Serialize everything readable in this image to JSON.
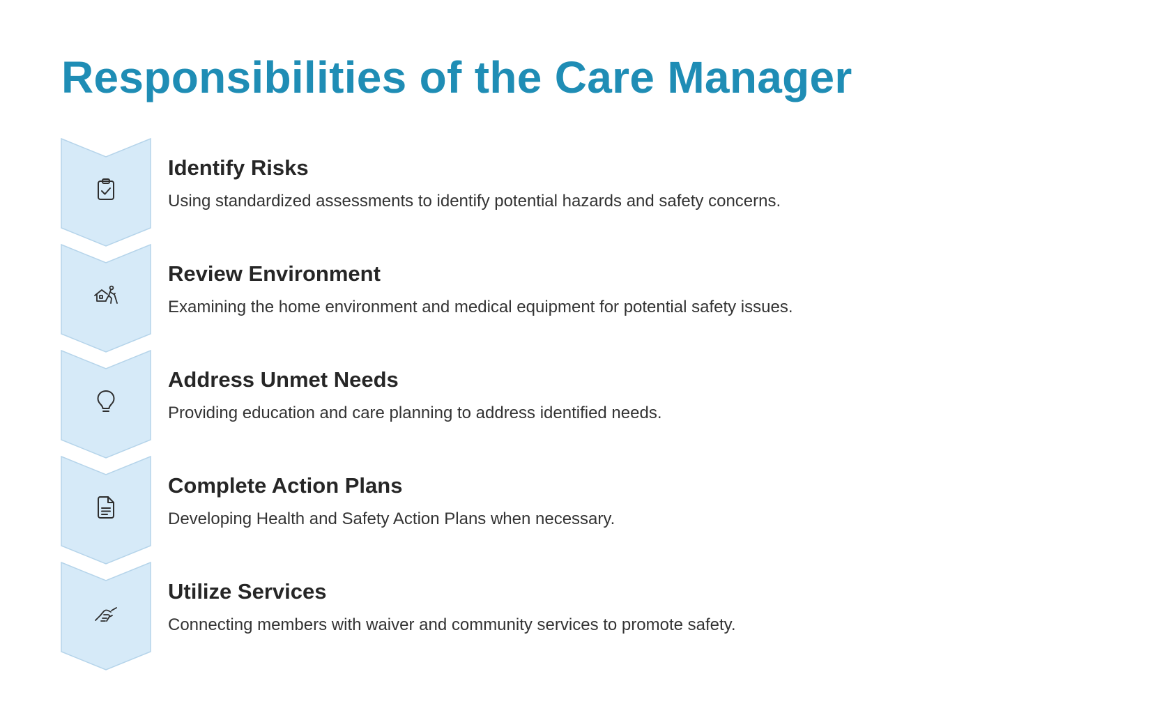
{
  "page": {
    "title": "Responsibilities of the Care Manager"
  },
  "colors": {
    "title": "#1F8DB5",
    "chevron_fill": "#D6EAF8",
    "chevron_stroke": "#B5D4EA",
    "icon_stroke": "#2E2E2E"
  },
  "steps": [
    {
      "heading": "Identify Risks",
      "description": "Using standardized assessments to identify potential hazards and safety concerns.",
      "icon": "clipboard-check-icon"
    },
    {
      "heading": "Review Environment",
      "description": "Examining the home environment and medical equipment for potential safety issues.",
      "icon": "home-walker-icon"
    },
    {
      "heading": "Address Unmet Needs",
      "description": "Providing education and care planning to address identified needs.",
      "icon": "lightbulb-icon"
    },
    {
      "heading": "Complete Action Plans",
      "description": "Developing Health and Safety Action Plans when necessary.",
      "icon": "document-icon"
    },
    {
      "heading": "Utilize Services",
      "description": "Connecting members with waiver and community services to promote safety.",
      "icon": "handshake-icon"
    }
  ]
}
